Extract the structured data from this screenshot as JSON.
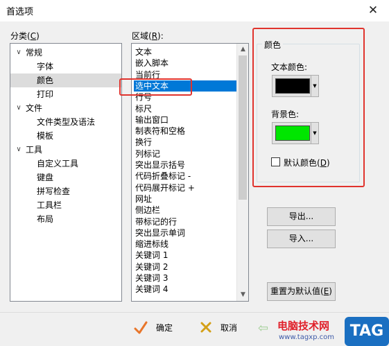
{
  "window": {
    "title": "首选项"
  },
  "category": {
    "label": "分类(",
    "hotkey": "C",
    "label_end": ")",
    "items": [
      {
        "label": "常规",
        "level": 0,
        "toggle": "∨"
      },
      {
        "label": "字体",
        "level": 1
      },
      {
        "label": "颜色",
        "level": 1,
        "selected": true
      },
      {
        "label": "打印",
        "level": 1
      },
      {
        "label": "文件",
        "level": 0,
        "toggle": "∨"
      },
      {
        "label": "文件类型及语法",
        "level": 1
      },
      {
        "label": "模板",
        "level": 1
      },
      {
        "label": "工具",
        "level": 0,
        "toggle": "∨"
      },
      {
        "label": "自定义工具",
        "level": 1
      },
      {
        "label": "键盘",
        "level": 1
      },
      {
        "label": "拼写检查",
        "level": 1
      },
      {
        "label": "工具栏",
        "level": 1
      },
      {
        "label": "布局",
        "level": 1
      }
    ]
  },
  "region": {
    "label": "区域(",
    "hotkey": "R",
    "label_end": "):",
    "items": [
      {
        "label": "文本"
      },
      {
        "label": "嵌入脚本"
      },
      {
        "label": "当前行"
      },
      {
        "label": "选中文本",
        "selected": true
      },
      {
        "label": "行号"
      },
      {
        "label": "标尺"
      },
      {
        "label": "输出窗口"
      },
      {
        "label": "制表符和空格"
      },
      {
        "label": "换行"
      },
      {
        "label": "列标记"
      },
      {
        "label": "突出显示括号"
      },
      {
        "label": "代码折叠标记 -"
      },
      {
        "label": "代码展开标记 +"
      },
      {
        "label": "网址"
      },
      {
        "label": "侧边栏"
      },
      {
        "label": "带标记的行"
      },
      {
        "label": "突出显示单词"
      },
      {
        "label": "缩进标线"
      },
      {
        "label": "关键词 1"
      },
      {
        "label": "关键词 2"
      },
      {
        "label": "关键词 3"
      },
      {
        "label": "关键词 4"
      }
    ]
  },
  "colors": {
    "group_label": "颜色",
    "text_color_label": "文本颜色:",
    "text_color": "#000000",
    "bg_color_label": "背景色:",
    "bg_color": "#00e600",
    "default_checkbox_label": "默认颜色(",
    "default_checkbox_hotkey": "D",
    "default_checkbox_end": ")",
    "default_checked": false
  },
  "buttons": {
    "export": "导出...",
    "import": "导入...",
    "reset": "重置为默认值(",
    "reset_hotkey": "E",
    "reset_end": ")",
    "ok": "确定",
    "cancel": "取消"
  },
  "watermark": {
    "site_name": "电脑技术网",
    "url": "www.tagxp.com",
    "tag": "TAG"
  },
  "accent": {
    "selection": "#0078d7",
    "highlight_box": "#e0332d"
  }
}
